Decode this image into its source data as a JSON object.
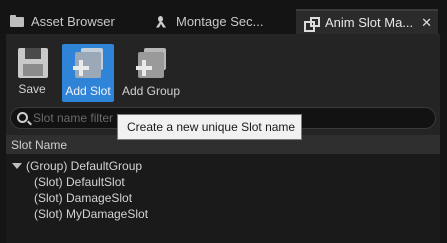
{
  "tabs": [
    {
      "label": "Asset Browser",
      "icon": "folder-icon",
      "active": false
    },
    {
      "label": "Montage Sec...",
      "icon": "montage-icon",
      "active": false
    },
    {
      "label": "Anim Slot Ma...",
      "icon": "slot-icon",
      "active": true,
      "close": "✕"
    }
  ],
  "toolbar": {
    "save_label": "Save",
    "add_slot_label": "Add Slot",
    "add_group_label": "Add Group"
  },
  "search": {
    "placeholder": "Slot name filter"
  },
  "column_header": "Slot Name",
  "tree": {
    "group": "(Group) DefaultGroup",
    "slots": [
      "(Slot) DefaultSlot",
      "(Slot) DamageSlot",
      "(Slot) MyDamageSlot"
    ]
  },
  "tooltip": "Create a new unique Slot name",
  "colors": {
    "accent": "#2f84d8",
    "background": "#242424",
    "tree_background": "#1a1a1a"
  }
}
